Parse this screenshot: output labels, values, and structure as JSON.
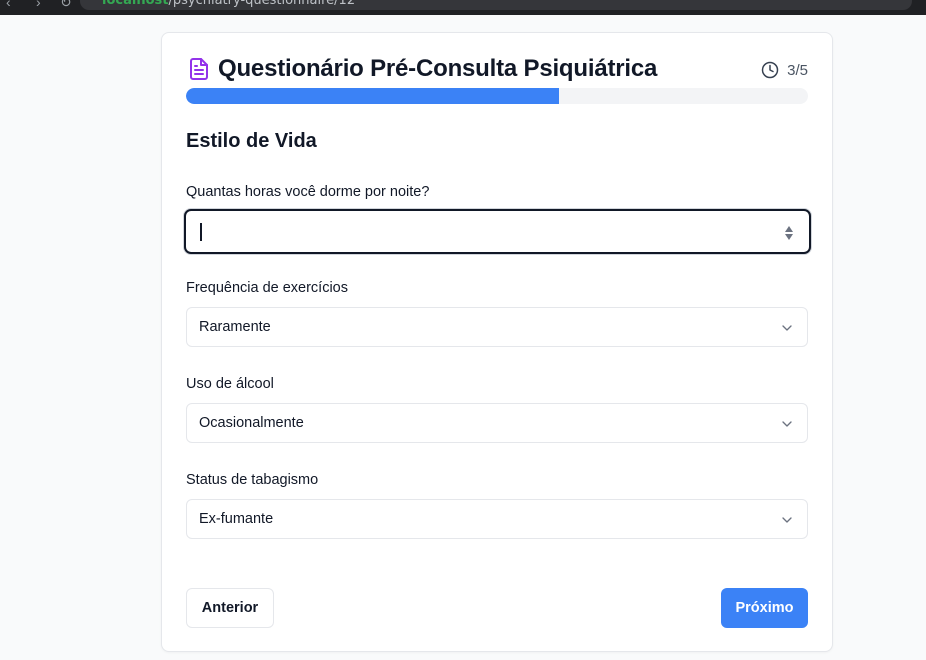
{
  "browser": {
    "url_host": "localhost",
    "url_path": "/psychiatry-questionnaire/12"
  },
  "header": {
    "title": "Questionário Pré-Consulta Psiquiátrica",
    "step": "3/5",
    "progress_fraction": 0.6,
    "icon": "document-icon",
    "accent_color": "#9333ea"
  },
  "section": {
    "title": "Estilo de Vida"
  },
  "fields": {
    "sleep": {
      "label": "Quantas horas você dorme por noite?",
      "value": ""
    },
    "exercise": {
      "label": "Frequência de exercícios",
      "value": "Raramente"
    },
    "alcohol": {
      "label": "Uso de álcool",
      "value": "Ocasionalmente"
    },
    "smoking": {
      "label": "Status de tabagismo",
      "value": "Ex-fumante"
    }
  },
  "buttons": {
    "previous": "Anterior",
    "next": "Próximo"
  },
  "colors": {
    "primary": "#3b82f6",
    "track": "#f3f4f6"
  }
}
